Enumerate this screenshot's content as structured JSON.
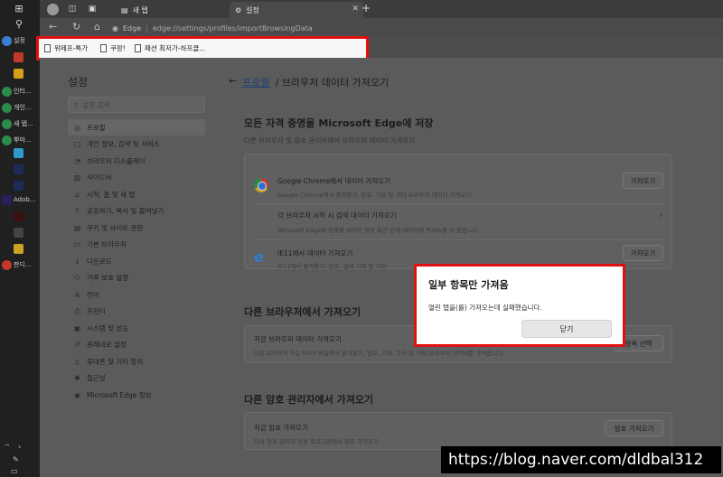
{
  "taskbar": {
    "apps": [
      {
        "label": "설정",
        "color": "#3a7fd5"
      },
      {
        "label": "인터...",
        "color": "#2d8a47"
      },
      {
        "label": "개인...",
        "color": "#2d8a47"
      },
      {
        "label": "새 탭...",
        "color": "#2d8a47"
      },
      {
        "label": "뿌마...",
        "color": "#2d8a47"
      }
    ],
    "adobe_label": "Adob...",
    "pandi_label": "판디..."
  },
  "browser": {
    "tab_inactive": "새 탭",
    "tab_active": "설정",
    "address_brand": "Edge",
    "address_url": "edge://settings/profiles/importBrowsingData"
  },
  "favorites": [
    {
      "label": "위메프-특가"
    },
    {
      "label": "쿠팡!"
    },
    {
      "label": "패션 최저가-하프클..."
    }
  ],
  "sidebar": {
    "title": "설정",
    "search_placeholder": "설정 검색",
    "items": [
      {
        "label": "프로필",
        "icon": "person-icon",
        "glyph": "◎"
      },
      {
        "label": "개인 정보, 검색 및 서비스",
        "icon": "lock-icon",
        "glyph": "▢"
      },
      {
        "label": "브라우저 디스플레이",
        "icon": "display-icon",
        "glyph": "◔"
      },
      {
        "label": "사이드바",
        "icon": "sidebar-icon",
        "glyph": "▥"
      },
      {
        "label": "시작, 홈 및 새 탭",
        "icon": "home-icon",
        "glyph": "⌂"
      },
      {
        "label": "공유하기, 복사 및 붙여넣기",
        "icon": "share-icon",
        "glyph": "⇪"
      },
      {
        "label": "쿠키 및 사이트 권한",
        "icon": "cookie-icon",
        "glyph": "▤"
      },
      {
        "label": "기본 브라우저",
        "icon": "browser-icon",
        "glyph": "▭"
      },
      {
        "label": "다운로드",
        "icon": "download-icon",
        "glyph": "↓"
      },
      {
        "label": "가족 보호 설정",
        "icon": "family-icon",
        "glyph": "⚇"
      },
      {
        "label": "언어",
        "icon": "language-icon",
        "glyph": "A"
      },
      {
        "label": "프린터",
        "icon": "printer-icon",
        "glyph": "⎙"
      },
      {
        "label": "시스템 및 성능",
        "icon": "system-icon",
        "glyph": "▣"
      },
      {
        "label": "원래대로 설정",
        "icon": "reset-icon",
        "glyph": "↺"
      },
      {
        "label": "휴대폰 및 기타 장치",
        "icon": "phone-icon",
        "glyph": "▯"
      },
      {
        "label": "접근성",
        "icon": "accessibility-icon",
        "glyph": "✱"
      },
      {
        "label": "Microsoft Edge 정보",
        "icon": "edge-icon",
        "glyph": "◉"
      }
    ]
  },
  "main": {
    "breadcrumb_link": "프로필",
    "breadcrumb_rest": "/ 브라우저 데이터 가져오기",
    "section1": {
      "title": "모든 자격 증명을 Microsoft Edge에 저장",
      "subtitle": "다른 브라우저 및 암호 관리자에서 브라우저 데이터 가져오기",
      "rows": [
        {
          "title": "Google Chrome에서 데이터 가져오기",
          "desc": "Google Chrome에서 즐겨찾기, 암호, 기록 및 기타 브라우저 데이터 가져오기",
          "button": "가져오기"
        },
        {
          "title": "각 브라우저 시작 시 검색 데이터 가져오기",
          "desc": "Microsoft Edge에 검색할 데이터 항상 최근 검색 데이터에 액세스할 수 있습니다."
        },
        {
          "title": "IE11에서 데이터 가져오기",
          "desc": "IE11에서 즐겨찾기, 암호, 검색 기록 및 기타",
          "button": "가져오기"
        }
      ]
    },
    "section2": {
      "title": "다른 브라우저에서 가져오기",
      "row_title": "지금 브라우저 데이터 가져오기",
      "row_desc": "다른 브라우저 또는 html 파일에서 즐겨찾기, 암호, 기록, 쿠키 및 기타 브라우저 데이터를 가져옵니다.",
      "button": "항목 선택"
    },
    "section3": {
      "title": "다른 암호 관리자에서 가져오기",
      "row_title": "지금 암호 가져오기",
      "row_desc": "타사 암호 관리자 응용 프로그램에서 암호 가져오기",
      "button": "암호 가져오기"
    }
  },
  "dialog": {
    "title": "일부 항목만 가져옴",
    "message": "열린 탭을(를) 가져오는데 실패했습니다.",
    "close_button": "닫기"
  },
  "watermark": "https://blog.naver.com/dldbal312"
}
